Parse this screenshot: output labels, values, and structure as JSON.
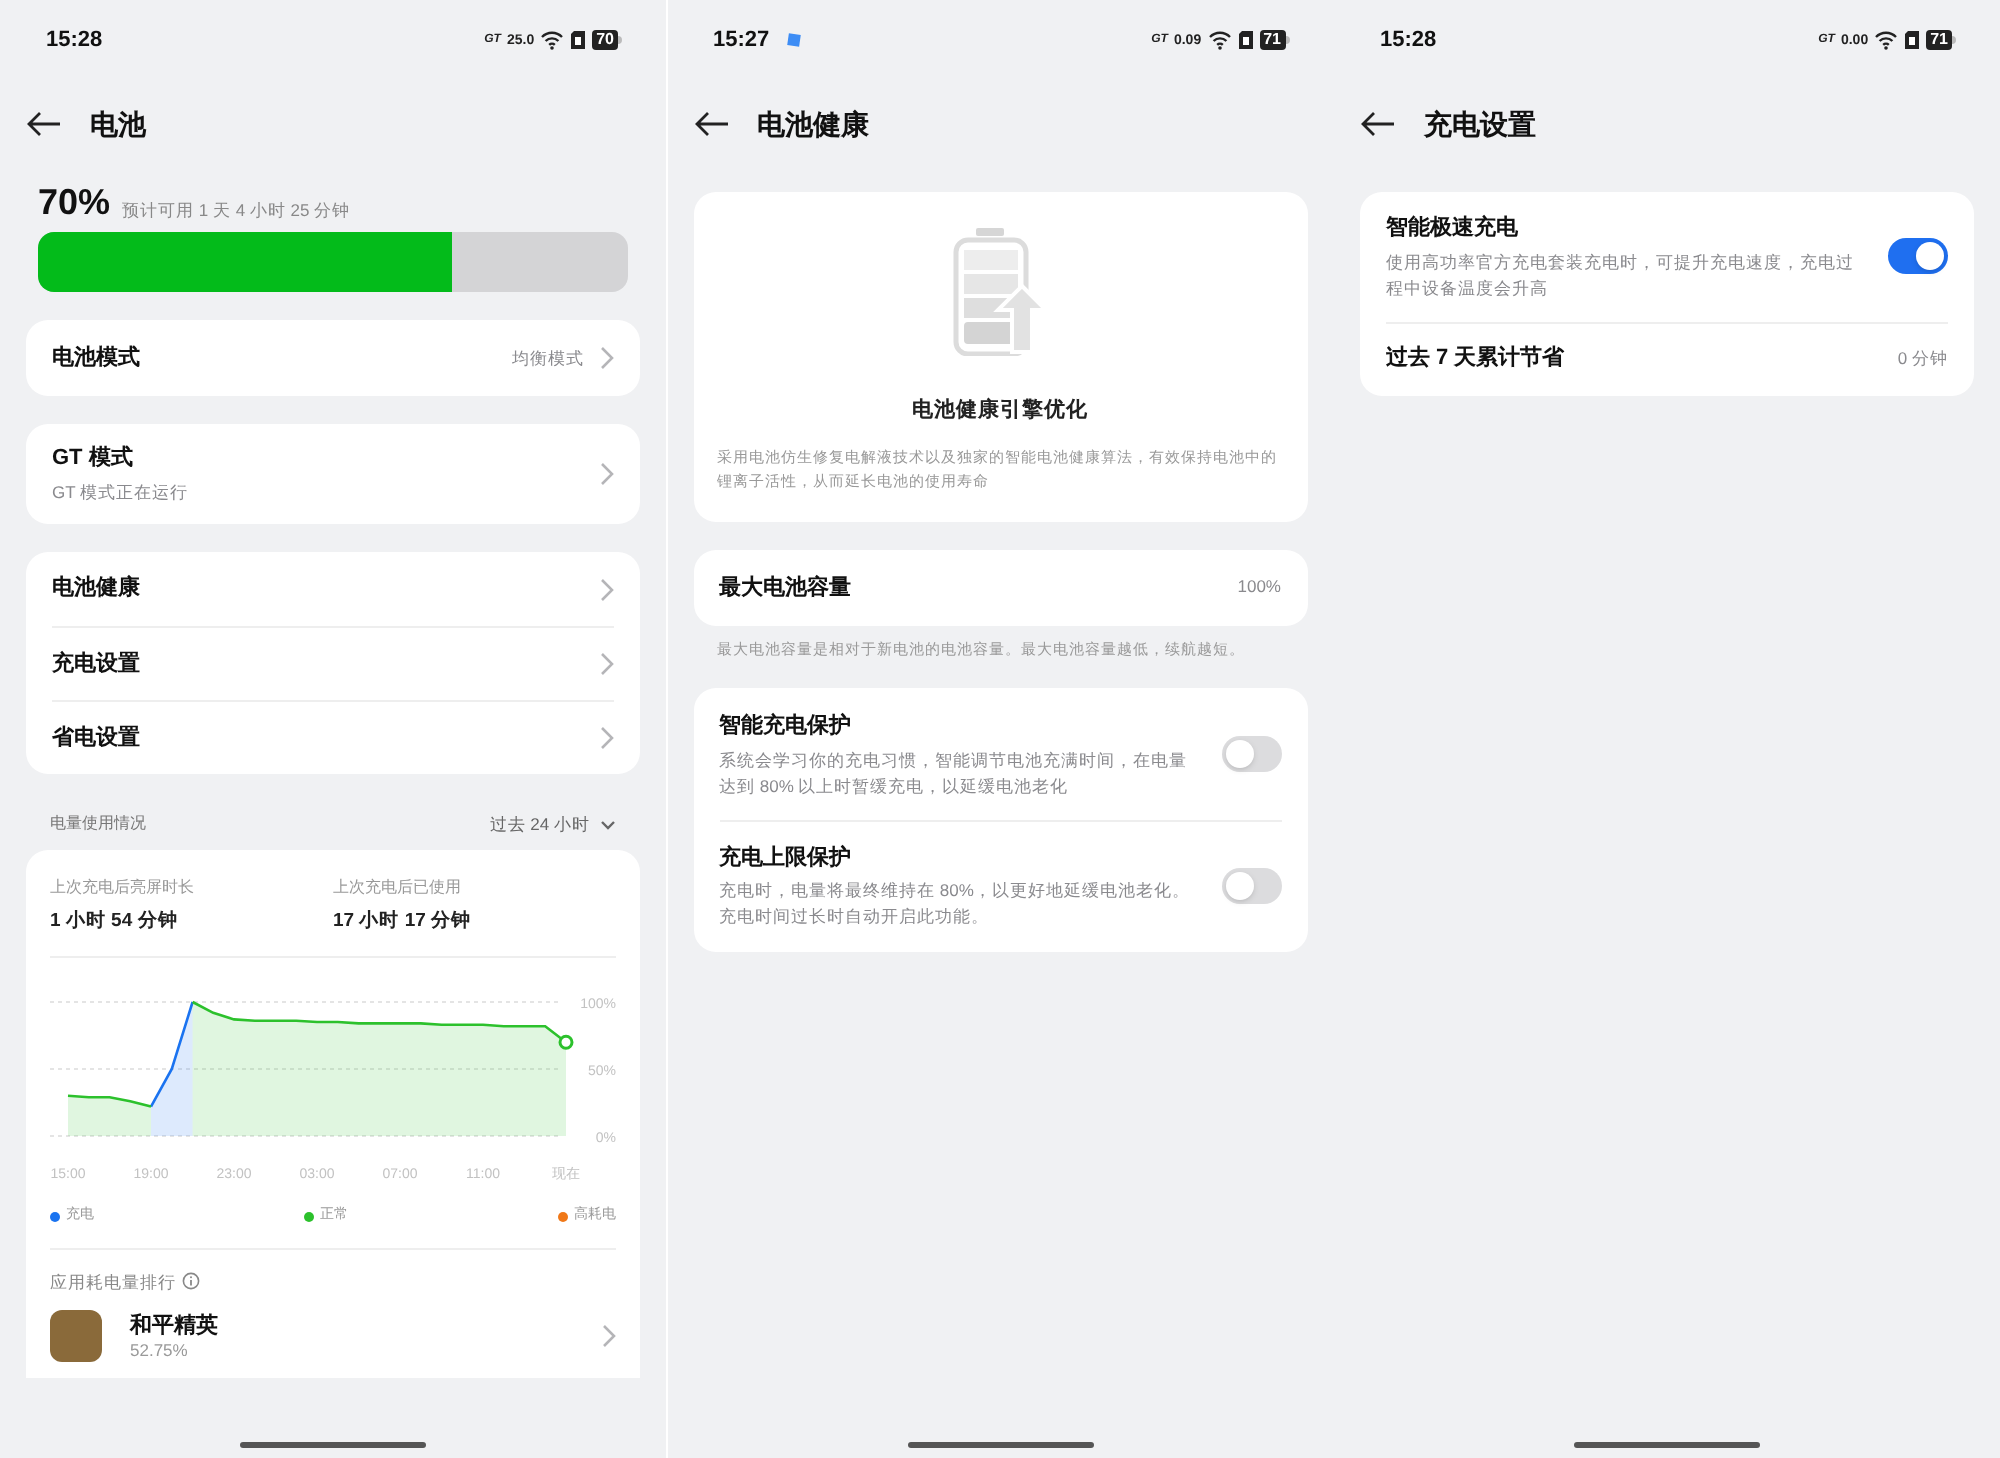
{
  "screens": [
    {
      "kind": "battery",
      "status_bar": {
        "time": "15:28",
        "badge": "GT",
        "net_speed": "25.0",
        "battery": "70",
        "sync": false
      },
      "title": "电池",
      "battery": {
        "percent": "70%",
        "estimate": "预计可用 1 天 4 小时 25 分钟",
        "level": 0.7
      },
      "groups": [
        [
          {
            "title": "电池模式",
            "value": "均衡模式"
          }
        ],
        [
          {
            "title": "GT 模式",
            "subtitle": "GT 模式正在运行"
          }
        ],
        [
          {
            "title": "电池健康"
          },
          {
            "title": "充电设置"
          },
          {
            "title": "省电设置"
          }
        ]
      ],
      "usage": {
        "heading": "电量使用情况",
        "range": "过去 24 小时",
        "stats": [
          {
            "label": "上次充电后亮屏时长",
            "value": "1 小时 54 分钟"
          },
          {
            "label": "上次充电后已使用",
            "value": "17 小时 17 分钟"
          }
        ],
        "chart_data": {
          "type": "area",
          "categories": [
            "15:00",
            null,
            null,
            null,
            "19:00",
            null,
            null,
            null,
            "23:00",
            null,
            null,
            null,
            "03:00",
            null,
            null,
            null,
            "07:00",
            null,
            null,
            null,
            "11:00",
            null,
            null,
            null,
            "现在"
          ],
          "series": [
            {
              "name": "充电",
              "color": "#1a73f0",
              "values": [
                null,
                null,
                null,
                null,
                22,
                50,
                100,
                null,
                null,
                null,
                null,
                null,
                null,
                null,
                null,
                null,
                null,
                null,
                null,
                null,
                null,
                null,
                null,
                null,
                null
              ]
            },
            {
              "name": "正常",
              "color": "#2cc12c",
              "values": [
                30,
                29,
                29,
                26,
                22,
                null,
                100,
                92,
                87,
                86,
                86,
                86,
                85,
                85,
                84,
                84,
                84,
                84,
                83,
                83,
                83,
                82,
                82,
                82,
                70
              ]
            },
            {
              "name": "高耗电",
              "color": "#f07818",
              "values": [
                null,
                null,
                null,
                null,
                null,
                null,
                null,
                null,
                null,
                null,
                null,
                null,
                null,
                null,
                null,
                null,
                null,
                null,
                null,
                null,
                null,
                null,
                null,
                null,
                null
              ]
            }
          ],
          "ylim": [
            0,
            100
          ],
          "yticks": [
            {
              "value": 0,
              "label": "0%"
            },
            {
              "value": 50,
              "label": "50%"
            },
            {
              "value": 100,
              "label": "100%"
            }
          ]
        },
        "ranking_heading": "应用耗电量排行",
        "apps": [
          {
            "name": "和平精英",
            "share": "52.75%"
          }
        ]
      }
    },
    {
      "kind": "health",
      "status_bar": {
        "time": "15:27",
        "badge": "GT",
        "net_speed": "0.09",
        "battery": "71",
        "sync": true
      },
      "title": "电池健康",
      "hero": {
        "title": "电池健康引擎优化",
        "description": "采用电池仿生修复电解液技术以及独家的智能电池健康算法，有效保持电池中的锂离子活性，从而延长电池的使用寿命"
      },
      "capacity": {
        "label": "最大电池容量",
        "value": "100%",
        "note": "最大电池容量是相对于新电池的电池容量。最大电池容量越低，续航越短。"
      },
      "toggles": [
        {
          "title": "智能充电保护",
          "description": "系统会学习你的充电习惯，智能调节电池充满时间，在电量达到 80% 以上时暂缓充电，以延缓电池老化",
          "on": false
        },
        {
          "title": "充电上限保护",
          "description": "充电时，电量将最终维持在 80%，以更好地延缓电池老化。充电时间过长时自动开启此功能。",
          "on": false
        }
      ]
    },
    {
      "kind": "charging",
      "status_bar": {
        "time": "15:28",
        "badge": "GT",
        "net_speed": "0.00",
        "battery": "71",
        "sync": false
      },
      "title": "充电设置",
      "toggles": [
        {
          "title": "智能极速充电",
          "description": "使用高功率官方充电套装充电时，可提升充电速度，充电过程中设备温度会升高",
          "on": true
        }
      ],
      "savings": {
        "label": "过去 7 天累计节省",
        "value": "0 分钟"
      }
    }
  ]
}
